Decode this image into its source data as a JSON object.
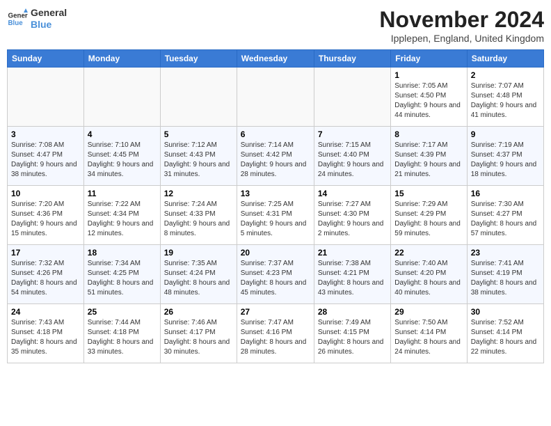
{
  "logo": {
    "line1": "General",
    "line2": "Blue"
  },
  "title": "November 2024",
  "location": "Ipplepen, England, United Kingdom",
  "headers": [
    "Sunday",
    "Monday",
    "Tuesday",
    "Wednesday",
    "Thursday",
    "Friday",
    "Saturday"
  ],
  "rows": [
    [
      {
        "day": "",
        "info": ""
      },
      {
        "day": "",
        "info": ""
      },
      {
        "day": "",
        "info": ""
      },
      {
        "day": "",
        "info": ""
      },
      {
        "day": "",
        "info": ""
      },
      {
        "day": "1",
        "info": "Sunrise: 7:05 AM\nSunset: 4:50 PM\nDaylight: 9 hours and 44 minutes."
      },
      {
        "day": "2",
        "info": "Sunrise: 7:07 AM\nSunset: 4:48 PM\nDaylight: 9 hours and 41 minutes."
      }
    ],
    [
      {
        "day": "3",
        "info": "Sunrise: 7:08 AM\nSunset: 4:47 PM\nDaylight: 9 hours and 38 minutes."
      },
      {
        "day": "4",
        "info": "Sunrise: 7:10 AM\nSunset: 4:45 PM\nDaylight: 9 hours and 34 minutes."
      },
      {
        "day": "5",
        "info": "Sunrise: 7:12 AM\nSunset: 4:43 PM\nDaylight: 9 hours and 31 minutes."
      },
      {
        "day": "6",
        "info": "Sunrise: 7:14 AM\nSunset: 4:42 PM\nDaylight: 9 hours and 28 minutes."
      },
      {
        "day": "7",
        "info": "Sunrise: 7:15 AM\nSunset: 4:40 PM\nDaylight: 9 hours and 24 minutes."
      },
      {
        "day": "8",
        "info": "Sunrise: 7:17 AM\nSunset: 4:39 PM\nDaylight: 9 hours and 21 minutes."
      },
      {
        "day": "9",
        "info": "Sunrise: 7:19 AM\nSunset: 4:37 PM\nDaylight: 9 hours and 18 minutes."
      }
    ],
    [
      {
        "day": "10",
        "info": "Sunrise: 7:20 AM\nSunset: 4:36 PM\nDaylight: 9 hours and 15 minutes."
      },
      {
        "day": "11",
        "info": "Sunrise: 7:22 AM\nSunset: 4:34 PM\nDaylight: 9 hours and 12 minutes."
      },
      {
        "day": "12",
        "info": "Sunrise: 7:24 AM\nSunset: 4:33 PM\nDaylight: 9 hours and 8 minutes."
      },
      {
        "day": "13",
        "info": "Sunrise: 7:25 AM\nSunset: 4:31 PM\nDaylight: 9 hours and 5 minutes."
      },
      {
        "day": "14",
        "info": "Sunrise: 7:27 AM\nSunset: 4:30 PM\nDaylight: 9 hours and 2 minutes."
      },
      {
        "day": "15",
        "info": "Sunrise: 7:29 AM\nSunset: 4:29 PM\nDaylight: 8 hours and 59 minutes."
      },
      {
        "day": "16",
        "info": "Sunrise: 7:30 AM\nSunset: 4:27 PM\nDaylight: 8 hours and 57 minutes."
      }
    ],
    [
      {
        "day": "17",
        "info": "Sunrise: 7:32 AM\nSunset: 4:26 PM\nDaylight: 8 hours and 54 minutes."
      },
      {
        "day": "18",
        "info": "Sunrise: 7:34 AM\nSunset: 4:25 PM\nDaylight: 8 hours and 51 minutes."
      },
      {
        "day": "19",
        "info": "Sunrise: 7:35 AM\nSunset: 4:24 PM\nDaylight: 8 hours and 48 minutes."
      },
      {
        "day": "20",
        "info": "Sunrise: 7:37 AM\nSunset: 4:23 PM\nDaylight: 8 hours and 45 minutes."
      },
      {
        "day": "21",
        "info": "Sunrise: 7:38 AM\nSunset: 4:21 PM\nDaylight: 8 hours and 43 minutes."
      },
      {
        "day": "22",
        "info": "Sunrise: 7:40 AM\nSunset: 4:20 PM\nDaylight: 8 hours and 40 minutes."
      },
      {
        "day": "23",
        "info": "Sunrise: 7:41 AM\nSunset: 4:19 PM\nDaylight: 8 hours and 38 minutes."
      }
    ],
    [
      {
        "day": "24",
        "info": "Sunrise: 7:43 AM\nSunset: 4:18 PM\nDaylight: 8 hours and 35 minutes."
      },
      {
        "day": "25",
        "info": "Sunrise: 7:44 AM\nSunset: 4:18 PM\nDaylight: 8 hours and 33 minutes."
      },
      {
        "day": "26",
        "info": "Sunrise: 7:46 AM\nSunset: 4:17 PM\nDaylight: 8 hours and 30 minutes."
      },
      {
        "day": "27",
        "info": "Sunrise: 7:47 AM\nSunset: 4:16 PM\nDaylight: 8 hours and 28 minutes."
      },
      {
        "day": "28",
        "info": "Sunrise: 7:49 AM\nSunset: 4:15 PM\nDaylight: 8 hours and 26 minutes."
      },
      {
        "day": "29",
        "info": "Sunrise: 7:50 AM\nSunset: 4:14 PM\nDaylight: 8 hours and 24 minutes."
      },
      {
        "day": "30",
        "info": "Sunrise: 7:52 AM\nSunset: 4:14 PM\nDaylight: 8 hours and 22 minutes."
      }
    ]
  ]
}
